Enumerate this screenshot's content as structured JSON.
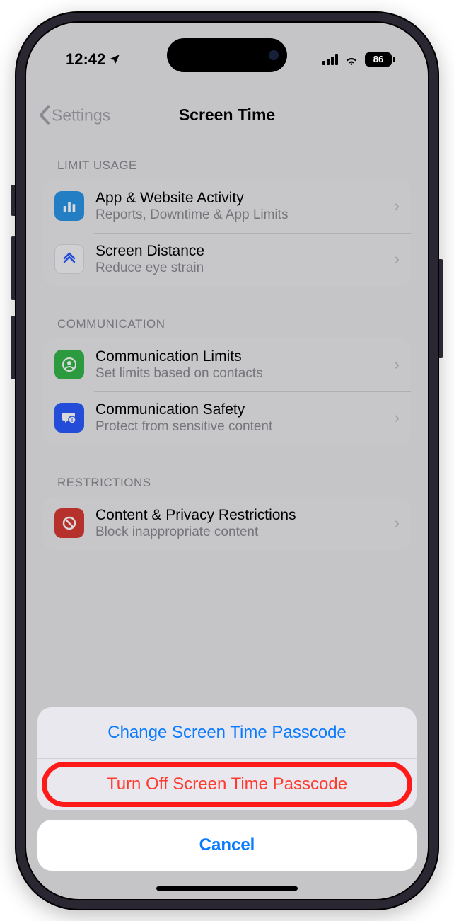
{
  "status": {
    "time": "12:42",
    "battery": "86"
  },
  "nav": {
    "back_label": "Settings",
    "title": "Screen Time"
  },
  "sections": {
    "usage": {
      "header": "LIMIT USAGE",
      "items": [
        {
          "title": "App & Website Activity",
          "subtitle": "Reports, Downtime & App Limits"
        },
        {
          "title": "Screen Distance",
          "subtitle": "Reduce eye strain"
        }
      ]
    },
    "communication": {
      "header": "COMMUNICATION",
      "items": [
        {
          "title": "Communication Limits",
          "subtitle": "Set limits based on contacts"
        },
        {
          "title": "Communication Safety",
          "subtitle": "Protect from sensitive content"
        }
      ]
    },
    "restrictions": {
      "header": "RESTRICTIONS",
      "items": [
        {
          "title": "Content & Privacy Restrictions",
          "subtitle": "Block inappropriate content"
        }
      ]
    }
  },
  "sheet": {
    "change": "Change Screen Time Passcode",
    "turn_off": "Turn Off Screen Time Passcode",
    "cancel": "Cancel"
  }
}
